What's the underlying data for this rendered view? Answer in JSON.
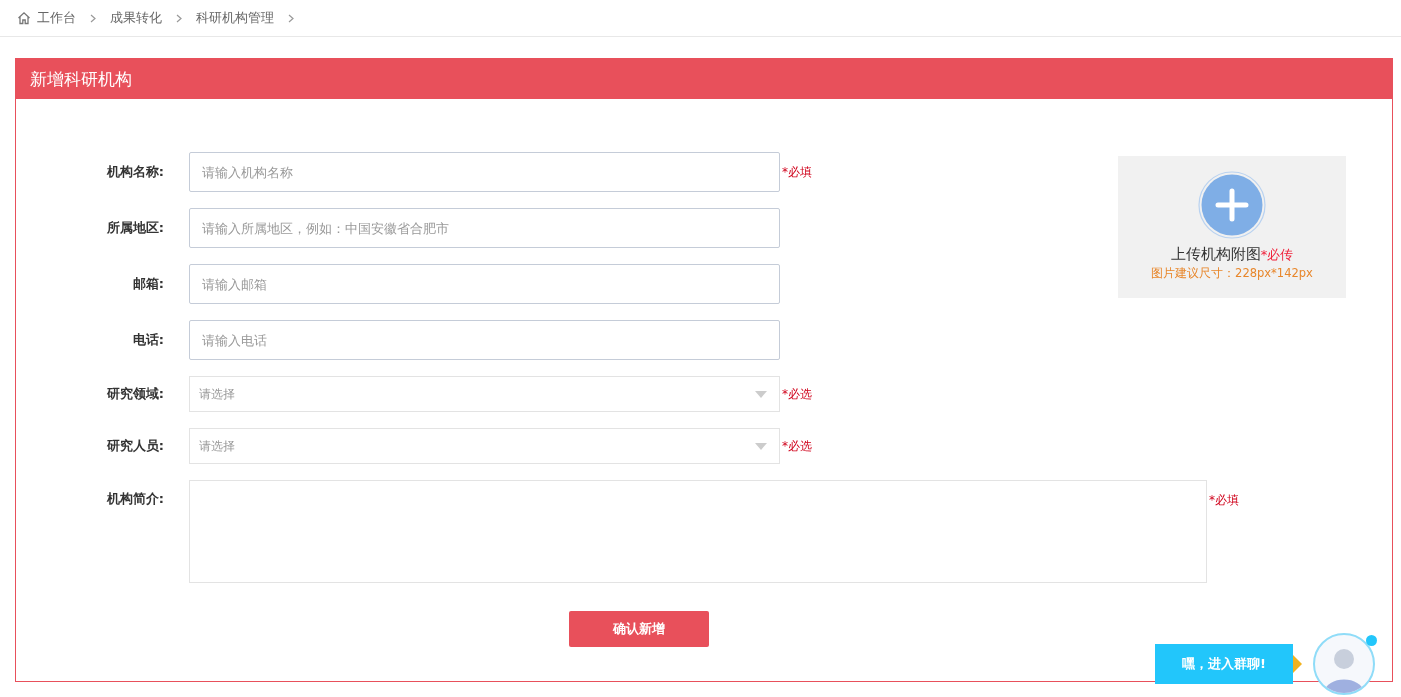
{
  "breadcrumb": [
    "工作台",
    "成果转化",
    "科研机构管理"
  ],
  "panel": {
    "title": "新增科研机构"
  },
  "fields": [
    {
      "kind": "text",
      "label": "机构名称:",
      "placeholder": "请输入机构名称",
      "note": "*必填"
    },
    {
      "kind": "text",
      "label": "所属地区:",
      "placeholder": "请输入所属地区，例如：中国安徽省合肥市"
    },
    {
      "kind": "text",
      "label": "邮箱:",
      "placeholder": "请输入邮箱"
    },
    {
      "kind": "text",
      "label": "电话:",
      "placeholder": "请输入电话"
    },
    {
      "kind": "select",
      "label": "研究领域:",
      "placeholder": "请选择",
      "note": "*必选"
    },
    {
      "kind": "select",
      "label": "研究人员:",
      "placeholder": "请选择",
      "note": "*必选"
    }
  ],
  "description": {
    "label": "机构简介:",
    "note": "*必填"
  },
  "upload": {
    "label": "上传机构附图",
    "required": "*必传",
    "hint": "图片建议尺寸：228px*142px"
  },
  "submit": "确认新增",
  "chat": {
    "label": "嘿，进入群聊!"
  }
}
